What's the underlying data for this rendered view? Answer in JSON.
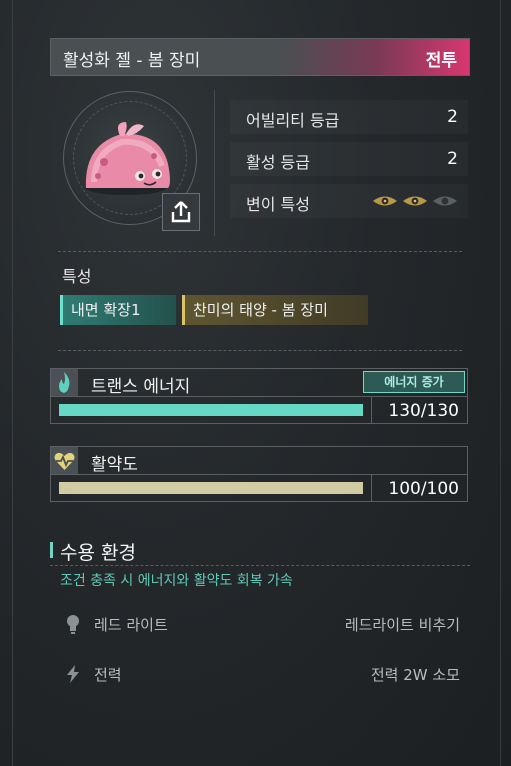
{
  "item": {
    "title": "활성화 젤 - 봄 장미",
    "tag": "전투",
    "tag_color": "#d6376f"
  },
  "stats": [
    {
      "label": "어빌리티 등급",
      "value": "2"
    },
    {
      "label": "활성 등급",
      "value": "2"
    },
    {
      "label": "변이 특성",
      "value": ""
    }
  ],
  "traits": {
    "label": "특성",
    "items": [
      "내면 확장1",
      "찬미의 태양 - 봄 장미"
    ]
  },
  "energy": {
    "label": "트랜스 에너지",
    "boost_label": "에너지 증가",
    "value_text": "130/130",
    "fill_fraction": 1.0,
    "color": "#66d8c6",
    "icon": "flame-icon"
  },
  "vitality": {
    "label": "활약도",
    "value_text": "100/100",
    "fill_fraction": 1.0,
    "color": "#d0cba3",
    "icon": "heart-pulse-icon"
  },
  "environment": {
    "title": "수용 환경",
    "description": "조건 충족 시 에너지와 활약도 회복 가속",
    "rows": [
      {
        "label": "레드 라이트",
        "value": "레드라이트 비추기",
        "icon": "bulb-icon"
      },
      {
        "label": "전력",
        "value": "전력 2W 소모",
        "icon": "lightning-icon"
      }
    ]
  }
}
